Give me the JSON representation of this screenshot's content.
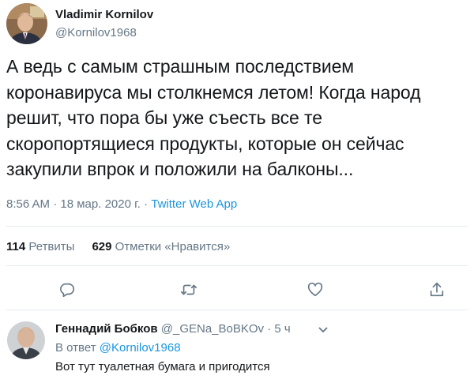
{
  "tweet": {
    "author_name": "Vladimir Kornilov",
    "author_handle": "@Kornilov1968",
    "text": "А ведь с самым страшным последствием коронавируса мы столкнемся летом! Когда народ решит, что пора бы уже съесть все те скоропортящиеся продукты, которые он сейчас закупили впрок и положили на балконы...",
    "time": "8:56 AM",
    "date": "18 мар. 2020 г.",
    "separator": "·",
    "source": "Twitter Web App"
  },
  "stats": {
    "retweets_count": "114",
    "retweets_label": "Ретвиты",
    "likes_count": "629",
    "likes_label": "Отметки «Нравится»"
  },
  "actions": [
    {
      "icon": "reply-icon"
    },
    {
      "icon": "retweet-icon"
    },
    {
      "icon": "like-icon"
    },
    {
      "icon": "share-icon"
    }
  ],
  "reply": {
    "author_name": "Геннадий Бобков",
    "author_handle": "@_GENa_BoBKOv",
    "separator": "·",
    "time_ago": "5 ч",
    "reply_to_label": "В ответ",
    "reply_to_handle": "@Kornilov1968",
    "text": "Вот тут туалетная бумага и пригодится"
  },
  "colors": {
    "link": "#1b95e0",
    "secondary_text": "#657786",
    "primary_text": "#14171a",
    "divider": "#e6ecf0"
  }
}
